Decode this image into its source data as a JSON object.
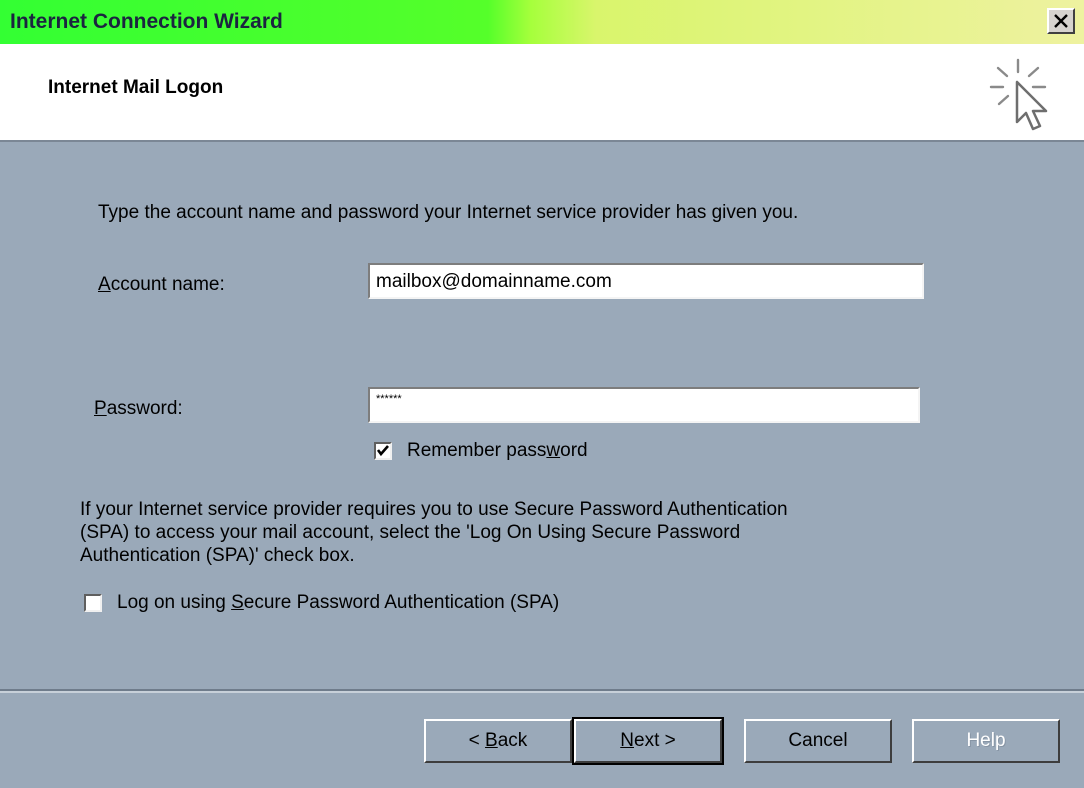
{
  "window": {
    "title": "Internet Connection Wizard",
    "close_glyph": "×"
  },
  "header": {
    "title": "Internet Mail Logon",
    "icon": "wizard-cursor-sparkle-icon"
  },
  "instructions": "Type the account name and password your Internet service provider has given you.",
  "account": {
    "label_prefix": "",
    "label_accel": "A",
    "label_rest": "ccount name:",
    "value": "mailbox@domainname.com"
  },
  "password": {
    "label_accel": "P",
    "label_rest": "assword:",
    "value": "******"
  },
  "remember": {
    "label_before": "Remember pass",
    "label_accel": "w",
    "label_after": "ord",
    "checked": true
  },
  "spa_info": {
    "line1": "If your Internet service provider requires you to use Secure Password Authentication",
    "line2": "(SPA) to access your mail account, select the 'Log On Using Secure Password",
    "line3": "Authentication (SPA)' check box."
  },
  "spa_checkbox": {
    "label_before": "Log on using ",
    "label_accel": "S",
    "label_after": "ecure Password Authentication (SPA)",
    "checked": false
  },
  "buttons": {
    "back_prefix": "< ",
    "back_accel": "B",
    "back_rest": "ack",
    "next_accel": "N",
    "next_rest": "ext >",
    "cancel": "Cancel",
    "help": "Help"
  }
}
